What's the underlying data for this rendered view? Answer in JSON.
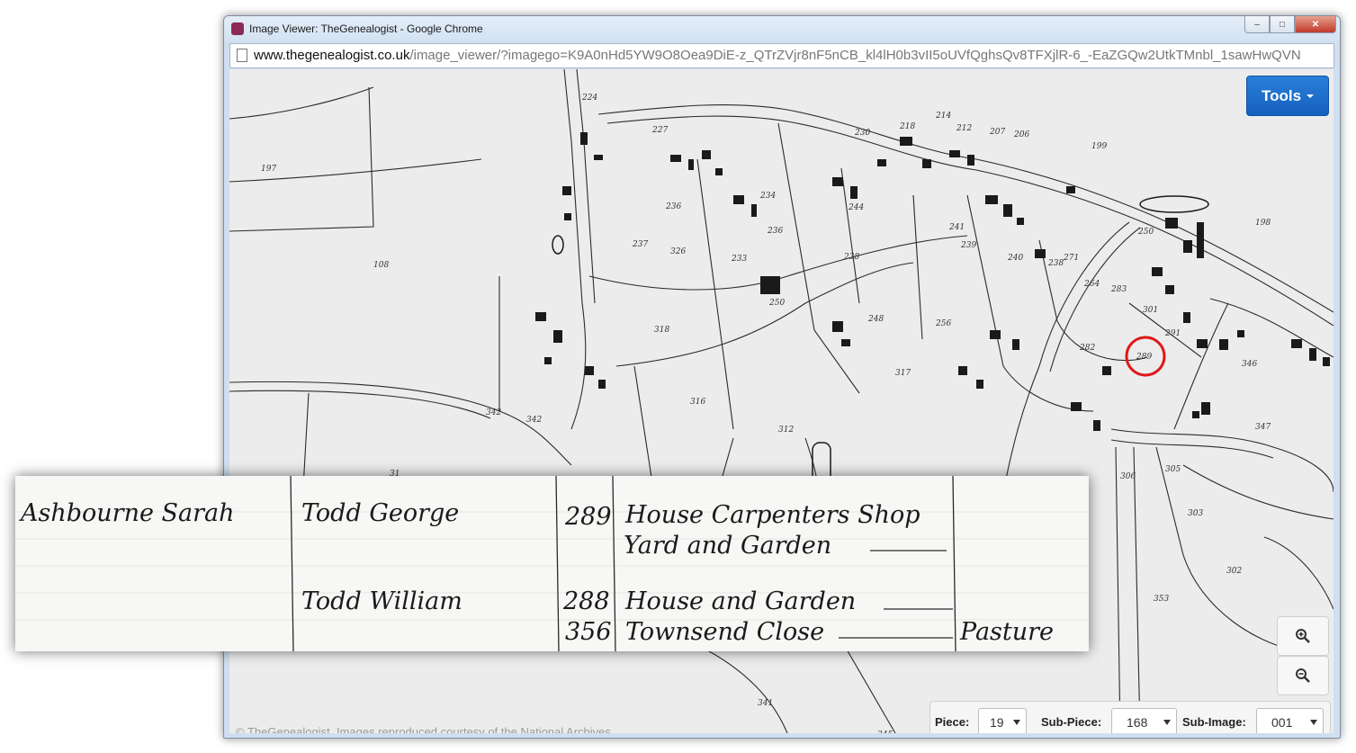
{
  "window": {
    "title": "Image Viewer: TheGenealogist - Google Chrome",
    "controls": {
      "minimize": "–",
      "maximize": "□",
      "close": "✕"
    }
  },
  "address": {
    "host": "www.thegenealogist.co.uk",
    "path": "/image_viewer/?imagego=K9A0nHd5YW9O8Oea9DiE-z_QTrZVjr8nF5nCB_kl4lH0b3vII5oUVfQghsQv8TFXjlR-6_-EaZGQw2UtkTMnbl_1sawHwQVN"
  },
  "toolbar": {
    "tools_label": "Tools"
  },
  "icons": {
    "zoom_in": "zoom-in-icon",
    "zoom_out": "zoom-out-icon"
  },
  "map": {
    "plot_numbers": [
      "224",
      "227",
      "230",
      "218",
      "214",
      "212",
      "207",
      "206",
      "199",
      "198",
      "197",
      "108",
      "236",
      "234",
      "236",
      "237",
      "233",
      "238",
      "244",
      "241",
      "239",
      "240",
      "250",
      "238",
      "271",
      "264",
      "283",
      "301",
      "291",
      "248",
      "256",
      "250",
      "318",
      "326",
      "282",
      "289",
      "317",
      "316",
      "312",
      "342",
      "342",
      "346",
      "347",
      "305",
      "306",
      "303",
      "302",
      "353",
      "341",
      "345",
      "31"
    ]
  },
  "copyright": "© TheGenealogist. Images reproduced courtesy of the National Archives",
  "selectors": {
    "piece": {
      "label": "Piece:",
      "value": "19"
    },
    "sub_piece": {
      "label": "Sub-Piece:",
      "value": "168"
    },
    "sub_image": {
      "label": "Sub-Image:",
      "value": "001"
    }
  },
  "schedule": {
    "owner": "Ashbourne Sarah",
    "rows": [
      {
        "occupier": "Todd George",
        "number": "289",
        "description": "House Carpenters Shop",
        "description2": "Yard and Garden",
        "cultivation": ""
      },
      {
        "occupier": "Todd William",
        "number": "288",
        "description": "House and Garden",
        "description2": "",
        "cultivation": ""
      },
      {
        "occupier": "",
        "number": "356",
        "description": "Townsend Close",
        "description2": "",
        "cultivation": "Pasture"
      }
    ]
  },
  "colors": {
    "tools_blue": "#1f6fd0",
    "highlight_red": "#e01818"
  }
}
